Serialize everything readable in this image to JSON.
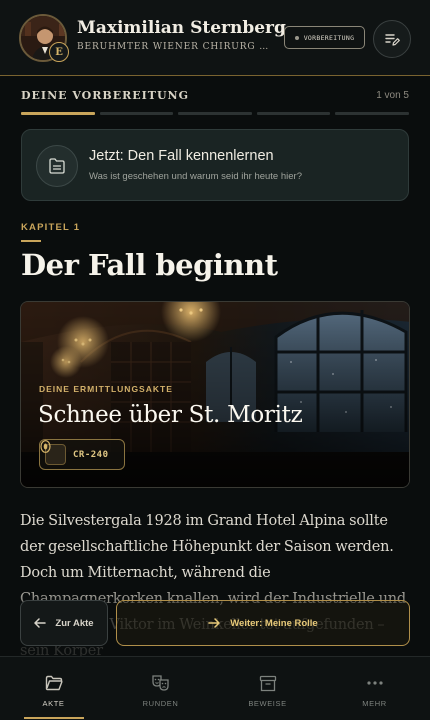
{
  "header": {
    "player_name": "Maximilian Sternberg",
    "player_role": "BERÜHMTER WIENER CHIRURG UND ...",
    "avatar_badge": "E",
    "status_label": "VORBEREITUNG",
    "notes_icon": "notes-edit-icon"
  },
  "progress": {
    "label": "DEINE VORBEREITUNG",
    "count": "1 von 5",
    "current": 1,
    "total": 5
  },
  "step": {
    "title": "Jetzt: Den Fall kennenlernen",
    "subtitle": "Was ist geschehen und warum seid ihr heute hier?",
    "icon": "file-document-icon"
  },
  "chapter": {
    "label": "KAPITEL 1",
    "title": "Der Fall beginnt"
  },
  "case_file": {
    "kicker": "DEINE ERMITTLUNGSAKTE",
    "title": "Schnee über St. Moritz",
    "code": "CR-240"
  },
  "story": {
    "text": "Die Silvestergala 1928 im Grand Hotel Alpina sollte der gesellschaftliche Höhepunkt der Saison werden. Doch um Mitternacht, während die Champagnerkorken knallen, wird der Industrielle und Hoteleigner Viktor im Weinkeller tot aufgefunden – sein Körper"
  },
  "actions": {
    "back_label": "Zur Akte",
    "next_label": "Weiter: Meine Rolle"
  },
  "nav": {
    "items": [
      {
        "label": "AKTE",
        "icon": "folder-icon",
        "active": true
      },
      {
        "label": "RUNDEN",
        "icon": "theater-masks-icon",
        "active": false
      },
      {
        "label": "BEWEISE",
        "icon": "archive-box-icon",
        "active": false
      },
      {
        "label": "MEHR",
        "icon": "more-dots-icon",
        "active": false
      }
    ]
  },
  "colors": {
    "accent": "#c9a55b",
    "background": "#0a0d0d",
    "card": "#1a2423"
  }
}
